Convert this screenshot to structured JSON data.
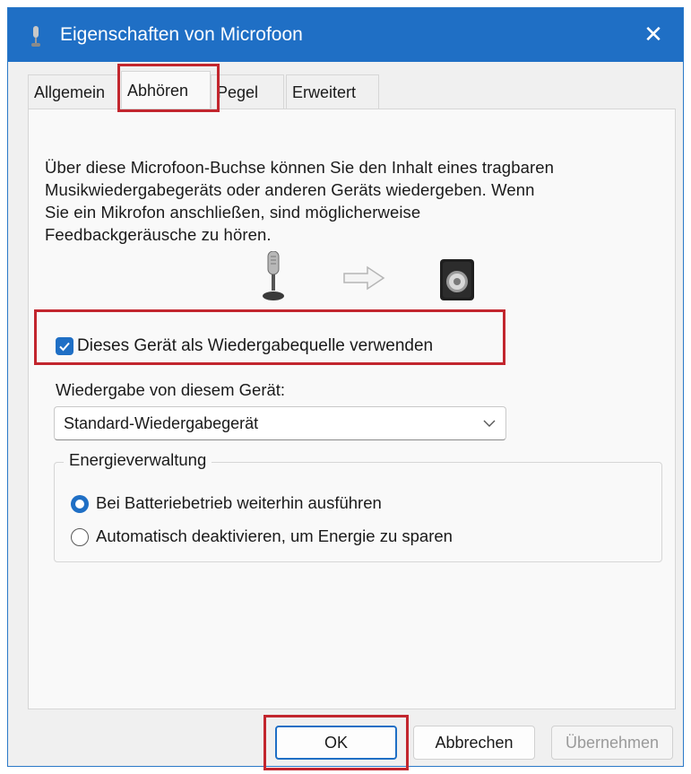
{
  "window": {
    "title": "Eigenschaften von Microfoon",
    "close_icon": "close-icon",
    "accent": "#1f6fc5",
    "highlight_color": "#c2262e"
  },
  "tabs": [
    {
      "label": "Allgemein",
      "active": false
    },
    {
      "label": "Abhören",
      "active": true
    },
    {
      "label": "Pegel",
      "active": false
    },
    {
      "label": "Erweitert",
      "active": false
    }
  ],
  "listen": {
    "description": "Über diese Microfoon-Buchse können Sie den Inhalt eines tragbaren\nMusikwiedergabegeräts oder anderen Geräts wiedergeben. Wenn\nSie ein Mikrofon anschließen, sind möglicherweise\nFeedbackgeräusche zu hören.",
    "illustration": [
      "microphone-icon",
      "arrow-right-icon",
      "speaker-icon"
    ],
    "use_as_source_label": "Dieses Gerät als Wiedergabequelle verwenden",
    "use_as_source_checked": true,
    "playback_label": "Wiedergabe von diesem Gerät:",
    "playback_device": "Standard-Wiedergabegerät"
  },
  "power": {
    "legend": "Energieverwaltung",
    "options": [
      {
        "label": "Bei Batteriebetrieb weiterhin ausführen",
        "selected": true
      },
      {
        "label": "Automatisch deaktivieren, um Energie zu sparen",
        "selected": false
      }
    ]
  },
  "buttons": {
    "ok": "OK",
    "cancel": "Abbrechen",
    "apply": "Übernehmen",
    "apply_enabled": false
  }
}
